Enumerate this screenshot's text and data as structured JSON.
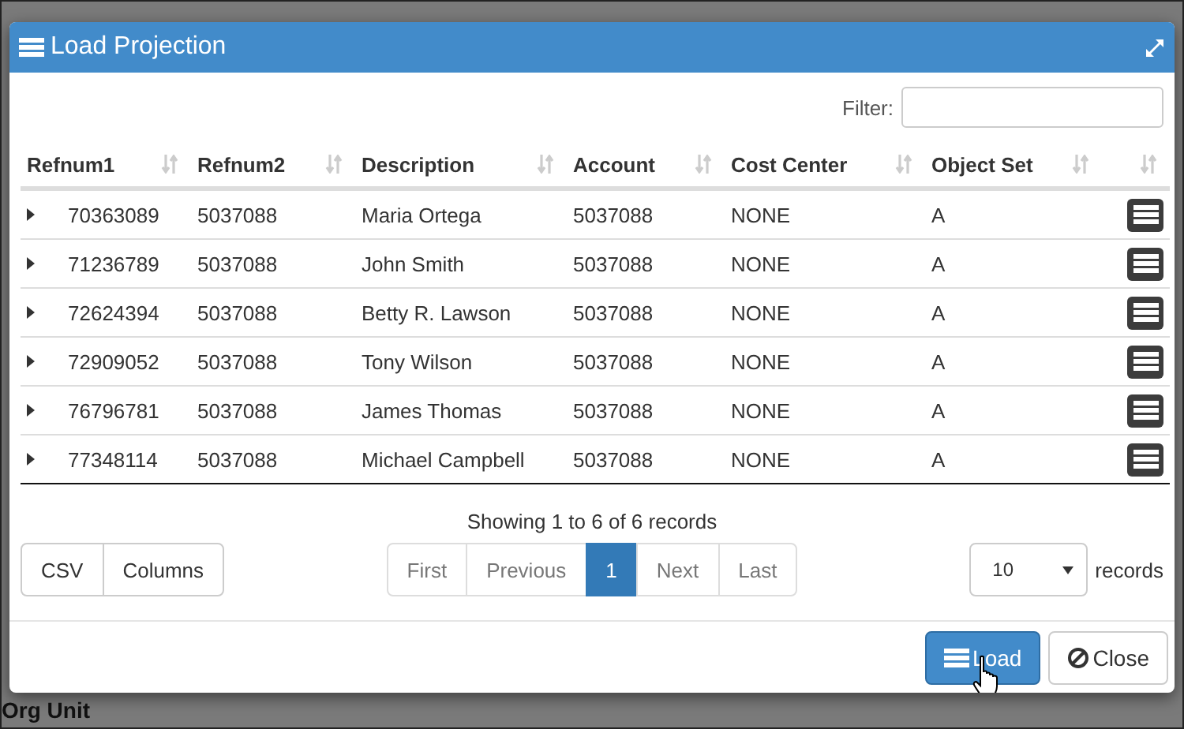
{
  "background": {
    "label": "Org Unit"
  },
  "dialog": {
    "title": "Load Projection",
    "filter": {
      "label": "Filter:"
    },
    "columns": [
      "Refnum1",
      "Refnum2",
      "Description",
      "Account",
      "Cost Center",
      "Object Set"
    ],
    "rows": [
      {
        "cells": [
          "70363089",
          "5037088",
          "Maria Ortega",
          "5037088",
          "NONE",
          "A"
        ]
      },
      {
        "cells": [
          "71236789",
          "5037088",
          "John Smith",
          "5037088",
          "NONE",
          "A"
        ]
      },
      {
        "cells": [
          "72624394",
          "5037088",
          "Betty R. Lawson",
          "5037088",
          "NONE",
          "A"
        ]
      },
      {
        "cells": [
          "72909052",
          "5037088",
          "Tony Wilson",
          "5037088",
          "NONE",
          "A"
        ]
      },
      {
        "cells": [
          "76796781",
          "5037088",
          "James Thomas",
          "5037088",
          "NONE",
          "A"
        ]
      },
      {
        "cells": [
          "77348114",
          "5037088",
          "Michael Campbell",
          "5037088",
          "NONE",
          "A"
        ]
      }
    ],
    "info": "Showing 1 to 6 of 6 records",
    "export_buttons": [
      "CSV",
      "Columns"
    ],
    "pagination": [
      {
        "label": "First",
        "selected": false
      },
      {
        "label": "Previous",
        "selected": false
      },
      {
        "label": "1",
        "selected": true
      },
      {
        "label": "Next",
        "selected": false
      },
      {
        "label": "Last",
        "selected": false
      }
    ],
    "page_length": {
      "value": "10",
      "label": "records"
    },
    "buttons": [
      {
        "kind": "primary",
        "label": "Load"
      },
      {
        "kind": "close",
        "label": "Close"
      }
    ]
  }
}
